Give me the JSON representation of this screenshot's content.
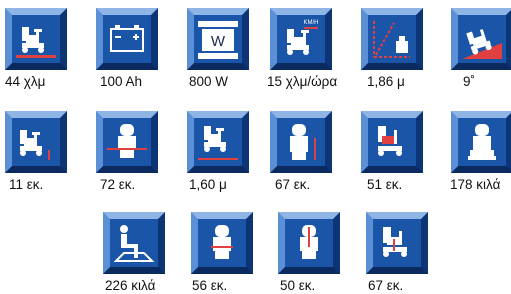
{
  "rows": [
    [
      {
        "icon": "scooter-range-icon",
        "value": "44 χλμ"
      },
      {
        "icon": "battery-icon",
        "value": "100 Ah"
      },
      {
        "icon": "motor-power-icon",
        "value": "800 W"
      },
      {
        "icon": "scooter-speed-icon",
        "value": "15 χλμ/ώρα"
      },
      {
        "icon": "turning-radius-icon",
        "value": "1,86 μ"
      },
      {
        "icon": "climbing-angle-icon",
        "value": "9˚"
      }
    ],
    [
      {
        "icon": "ground-clearance-icon",
        "value": "11 εκ."
      },
      {
        "icon": "total-width-icon",
        "value": "72 εκ."
      },
      {
        "icon": "total-length-icon",
        "value": "1,60 μ"
      },
      {
        "icon": "seat-height-icon",
        "value": "67 εκ."
      },
      {
        "icon": "seat-depth-icon",
        "value": "51 εκ."
      },
      {
        "icon": "scooter-weight-icon",
        "value": "178 κιλά"
      }
    ],
    [
      {
        "icon": "max-user-weight-icon",
        "value": "226 κιλά"
      },
      {
        "icon": "seat-width-icon",
        "value": "56 εκ."
      },
      {
        "icon": "backrest-height-icon",
        "value": "50 εκ."
      },
      {
        "icon": "armrest-height-icon",
        "value": "67 εκ."
      }
    ]
  ],
  "badges": {
    "speed": "KM/H",
    "power": "W"
  }
}
